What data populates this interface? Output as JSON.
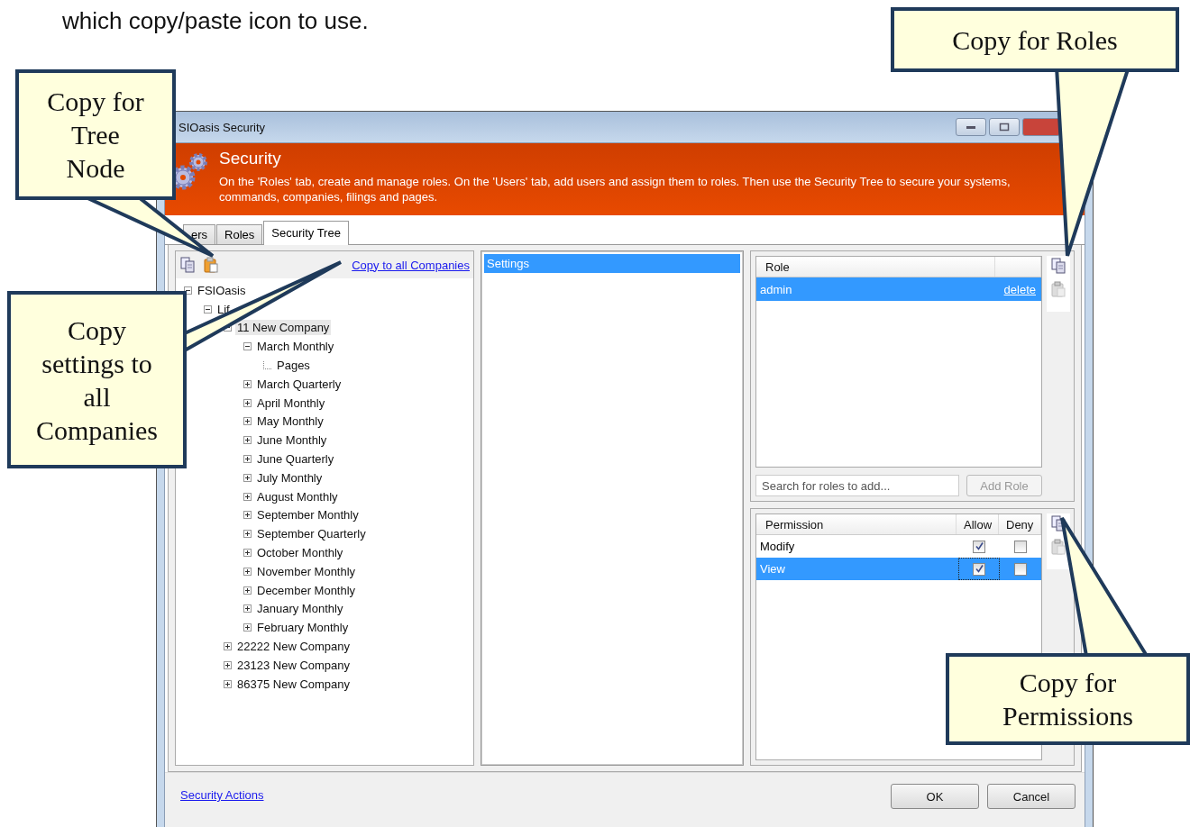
{
  "document_text": "which copy/paste icon to use.",
  "window": {
    "title": "SIOasis Security"
  },
  "header": {
    "title": "Security",
    "description": "On the 'Roles' tab, create and manage roles.  On the 'Users' tab, add users and assign them to roles.  Then use the Security Tree to secure your systems, commands, companies, filings and pages."
  },
  "tabs": [
    {
      "label": "ers",
      "selected": false
    },
    {
      "label": "Roles",
      "selected": false
    },
    {
      "label": "Security Tree",
      "selected": true
    }
  ],
  "tree_panel": {
    "paste_disabled": false,
    "link": "Copy to all Companies",
    "tree": [
      {
        "label": "FSIOasis",
        "expanded": true,
        "highlighted": false,
        "children": [
          {
            "label": "Lif",
            "expanded": true,
            "highlighted": false,
            "children": [
              {
                "label": "11 New Company",
                "expanded": true,
                "highlighted": true,
                "children": [
                  {
                    "label": "March Monthly",
                    "expanded": true,
                    "highlighted": false,
                    "children": [
                      {
                        "label": "Pages",
                        "highlighted": false
                      }
                    ]
                  },
                  {
                    "label": "March Quarterly",
                    "expanded": false,
                    "highlighted": false
                  },
                  {
                    "label": "April Monthly",
                    "expanded": false,
                    "highlighted": false
                  },
                  {
                    "label": "May Monthly",
                    "expanded": false,
                    "highlighted": false
                  },
                  {
                    "label": "June Monthly",
                    "expanded": false,
                    "highlighted": false
                  },
                  {
                    "label": "June Quarterly",
                    "expanded": false,
                    "highlighted": false
                  },
                  {
                    "label": "July Monthly",
                    "expanded": false,
                    "highlighted": false
                  },
                  {
                    "label": "August Monthly",
                    "expanded": false,
                    "highlighted": false
                  },
                  {
                    "label": "September Monthly",
                    "expanded": false,
                    "highlighted": false
                  },
                  {
                    "label": "September Quarterly",
                    "expanded": false,
                    "highlighted": false
                  },
                  {
                    "label": "October Monthly",
                    "expanded": false,
                    "highlighted": false
                  },
                  {
                    "label": "November Monthly",
                    "expanded": false,
                    "highlighted": false
                  },
                  {
                    "label": "December Monthly",
                    "expanded": false,
                    "highlighted": false
                  },
                  {
                    "label": "January Monthly",
                    "expanded": false,
                    "highlighted": false
                  },
                  {
                    "label": "February Monthly",
                    "expanded": false,
                    "highlighted": false
                  }
                ]
              },
              {
                "label": "22222 New Company",
                "expanded": false,
                "highlighted": false
              },
              {
                "label": "23123 New Company",
                "expanded": false,
                "highlighted": false
              },
              {
                "label": "86375 New Company",
                "expanded": false,
                "highlighted": false
              }
            ]
          }
        ]
      }
    ]
  },
  "settings_panel": {
    "items": [
      {
        "label": "Settings",
        "selected": true
      }
    ]
  },
  "roles": {
    "paste_disabled": true,
    "columns": [
      "Role"
    ],
    "rows": [
      {
        "name": "admin",
        "action": "delete",
        "selected": true
      }
    ],
    "search": {
      "placeholder": "Search for roles to add..."
    },
    "add_button": {
      "label": "Add Role",
      "disabled": true
    }
  },
  "permissions": {
    "paste_disabled": true,
    "columns": [
      "Permission",
      "Allow",
      "Deny"
    ],
    "rows": [
      {
        "name": "Modify",
        "allow": true,
        "deny": false,
        "selected": false
      },
      {
        "name": "View",
        "allow": true,
        "deny": false,
        "selected": true
      }
    ]
  },
  "footer": {
    "link": "Security Actions",
    "buttons": [
      "OK",
      "Cancel"
    ]
  },
  "callouts": [
    {
      "text": "Copy for\nTree\nNode"
    },
    {
      "text": "Copy\nsettings to\nall\nCompanies"
    },
    {
      "text": "Copy for Roles"
    },
    {
      "text": "Copy for\nPermissions"
    }
  ]
}
